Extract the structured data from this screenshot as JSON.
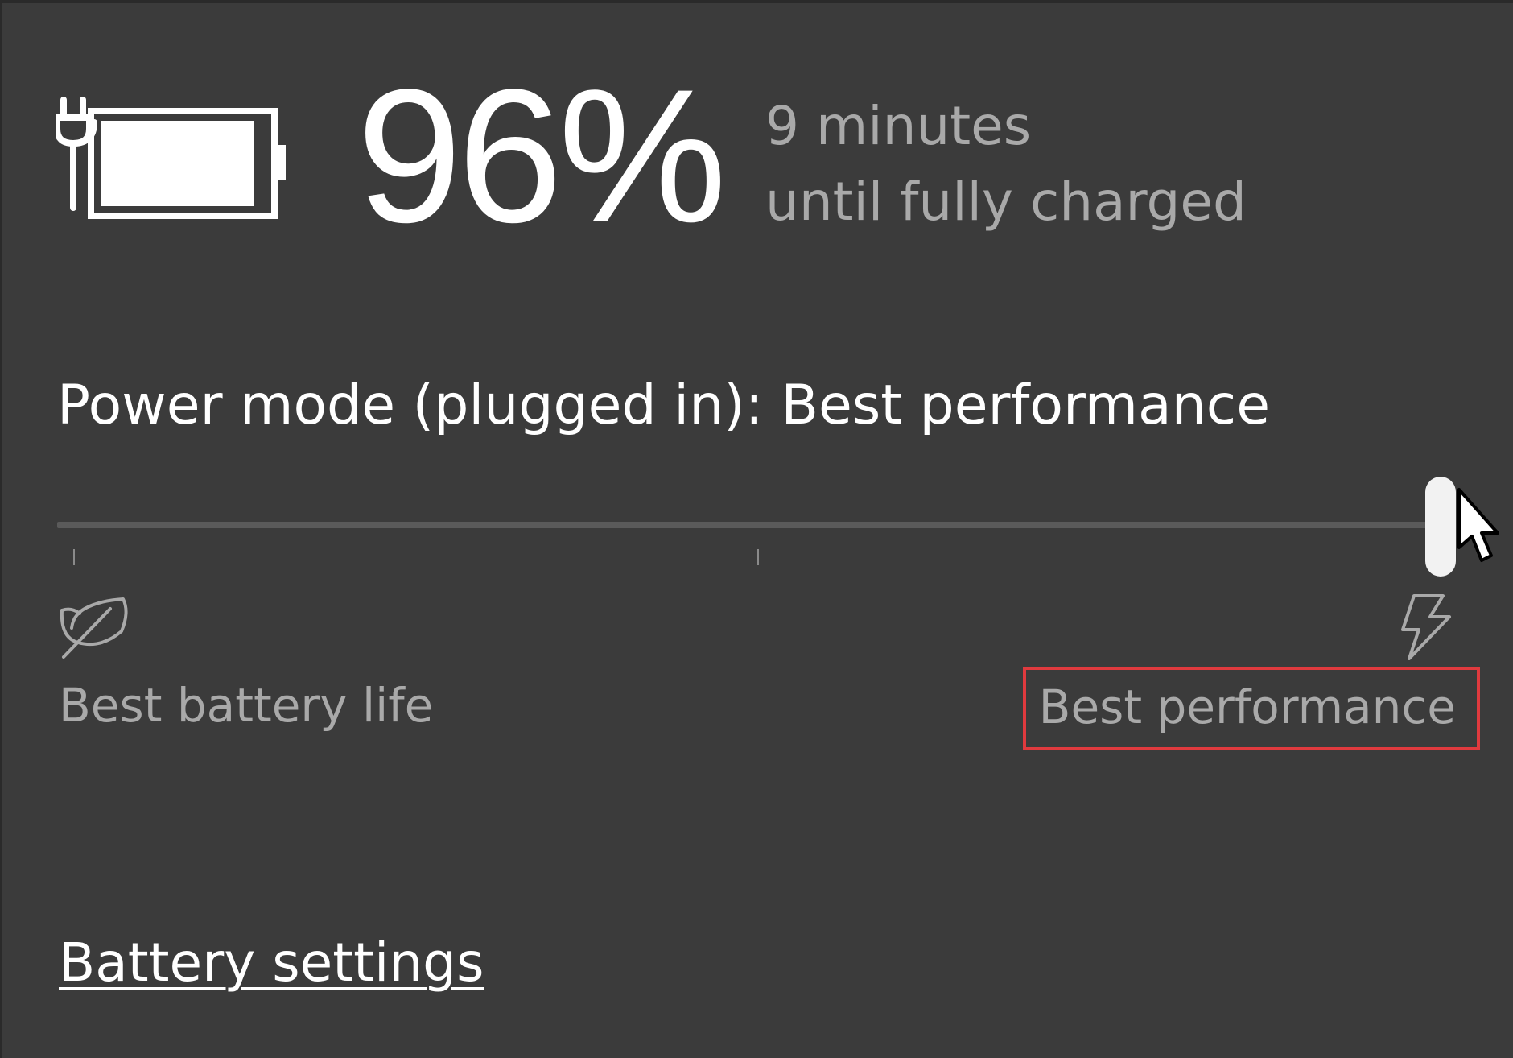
{
  "battery": {
    "percent_text": "96%",
    "level_fraction": 0.96,
    "charging": true,
    "icon": "battery-charging-icon",
    "time_line1": "9 minutes",
    "time_line2": "until fully charged"
  },
  "power_mode": {
    "title": "Power mode (plugged in): Best performance",
    "slider_level_fraction": 1.0,
    "tick_count": 3,
    "left_icon": "leaf-icon",
    "left_label": "Best battery life",
    "right_icon": "lightning-bolt-icon",
    "right_label": "Best performance",
    "highlight_color": "#e03a3e"
  },
  "footer": {
    "settings_link": "Battery settings"
  },
  "colors": {
    "background": "#3b3b3b",
    "primary_text": "#ffffff",
    "secondary_text": "#a9a9a9"
  }
}
